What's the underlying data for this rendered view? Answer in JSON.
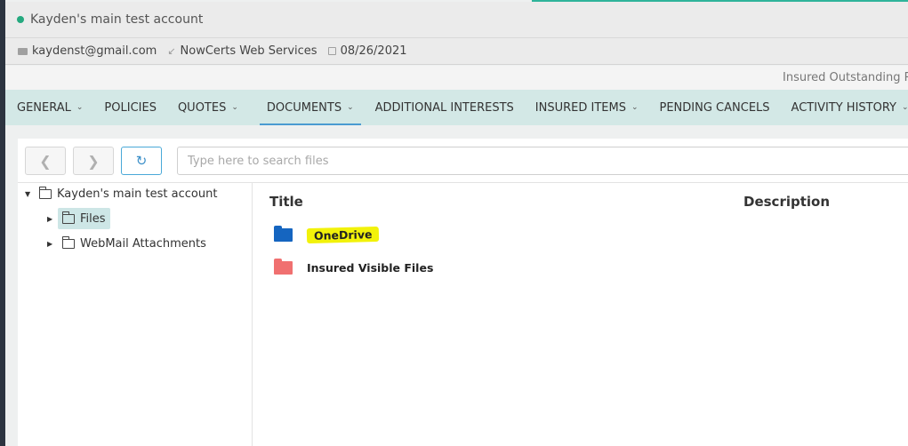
{
  "header": {
    "account_title": "Kayden's main test account",
    "email": "kaydenst@gmail.com",
    "agency": "NowCerts Web Services",
    "date": "08/26/2021",
    "notice": "Insured Outstanding Re",
    "colors": {
      "status": "#25a97f",
      "accent": "#2fb39a",
      "tab_bar": "#d3e8e6"
    }
  },
  "tabs": [
    {
      "label": "GENERAL",
      "has_dropdown": true
    },
    {
      "label": "POLICIES",
      "has_dropdown": false
    },
    {
      "label": "QUOTES",
      "has_dropdown": true
    },
    {
      "label": "DOCUMENTS",
      "has_dropdown": true,
      "active": true
    },
    {
      "label": "ADDITIONAL INTERESTS",
      "has_dropdown": false
    },
    {
      "label": "INSURED ITEMS",
      "has_dropdown": true
    },
    {
      "label": "PENDING CANCELS",
      "has_dropdown": false
    },
    {
      "label": "ACTIVITY HISTORY",
      "has_dropdown": true
    }
  ],
  "toolbar": {
    "back_icon": "chevron-left-icon",
    "forward_icon": "chevron-right-icon",
    "refresh_icon": "refresh-icon",
    "search_placeholder": "Type here to search files"
  },
  "tree": {
    "root": "Kayden's main test account",
    "children": [
      "Files",
      "WebMail Attachments"
    ],
    "selected": "Files"
  },
  "list": {
    "columns": [
      "Title",
      "Description"
    ],
    "rows": [
      {
        "name": "OneDrive",
        "icon": "folder-icon",
        "color": "#1565c0",
        "highlighted": true
      },
      {
        "name": "Insured Visible Files",
        "icon": "folder-icon",
        "color": "#f07070",
        "highlighted": false
      }
    ]
  }
}
